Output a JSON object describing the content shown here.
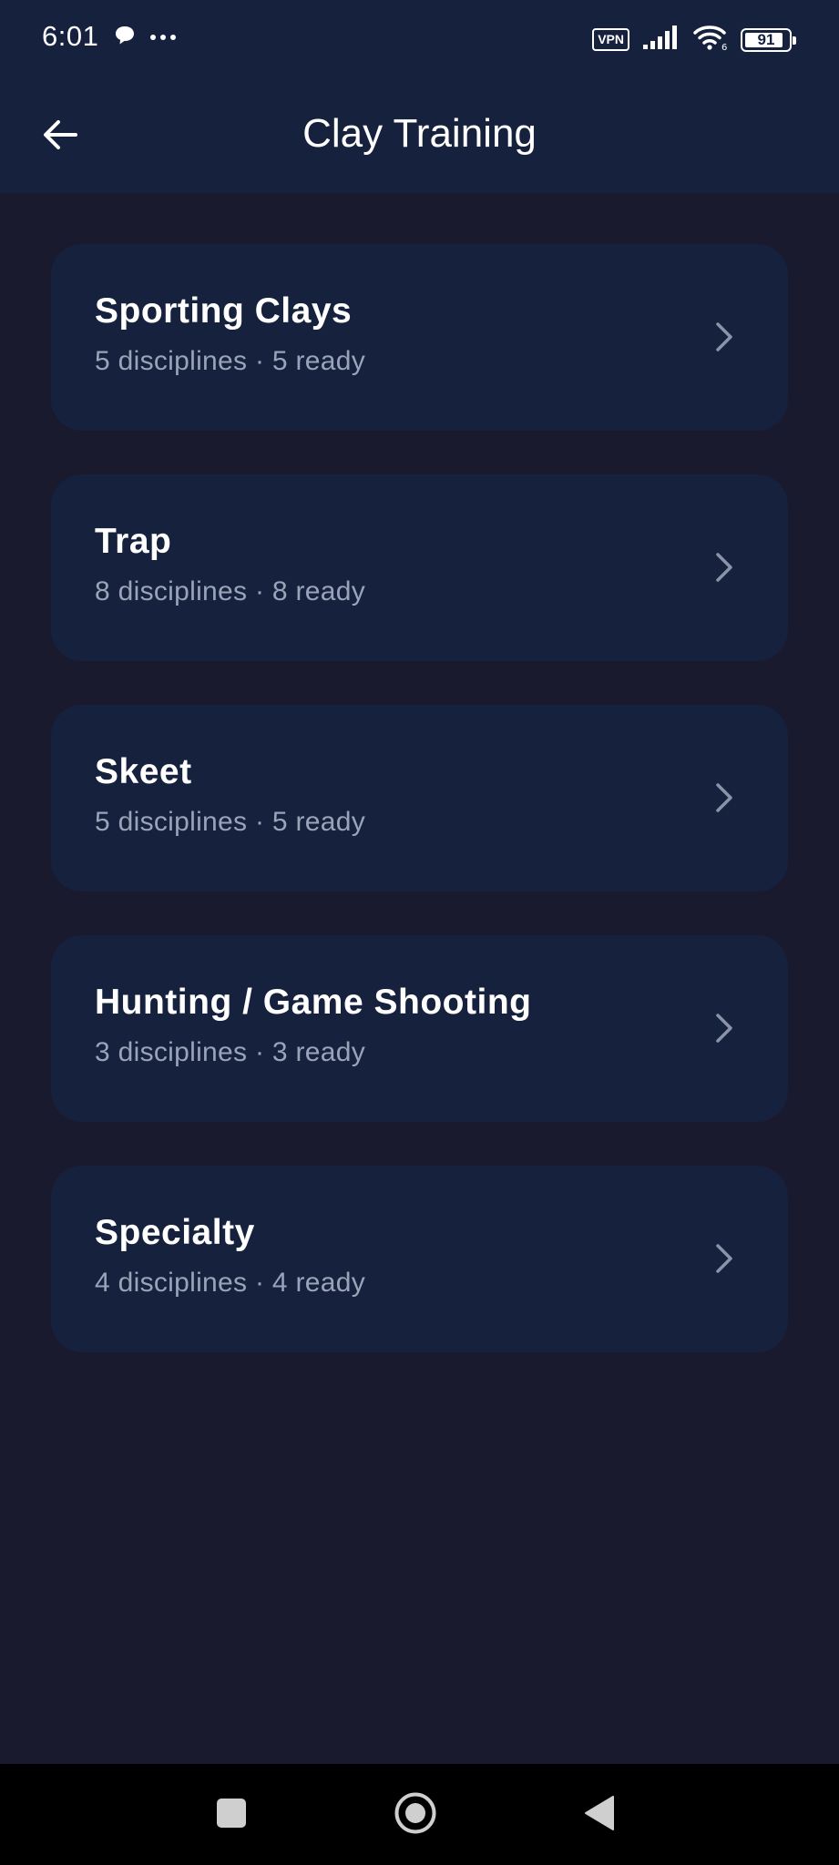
{
  "status_bar": {
    "time": "6:01",
    "vpn_label": "VPN",
    "battery_level": "91",
    "battery_fraction": 0.91,
    "icons": [
      "chat-bubble-icon",
      "more-dots-icon",
      "vpn-icon",
      "signal-icon",
      "wifi-icon",
      "battery-icon"
    ]
  },
  "app_bar": {
    "title": "Clay Training",
    "back_icon": "arrow-left-icon"
  },
  "categories": [
    {
      "title": "Sporting Clays",
      "subtitle": "5 disciplines · 5 ready"
    },
    {
      "title": "Trap",
      "subtitle": "8 disciplines · 8 ready"
    },
    {
      "title": "Skeet",
      "subtitle": "5 disciplines · 5 ready"
    },
    {
      "title": "Hunting / Game Shooting",
      "subtitle": "3 disciplines · 3 ready"
    },
    {
      "title": "Specialty",
      "subtitle": "4 disciplines · 4 ready"
    }
  ],
  "nav_bar": {
    "icons": [
      "recents-square-icon",
      "home-circle-icon",
      "back-triangle-icon"
    ]
  },
  "colors": {
    "background": "#1a1a2e",
    "surface": "#16213e",
    "text_primary": "#ffffff",
    "text_secondary": "#9aa3b8",
    "chevron": "#8a93a8",
    "nav_background": "#000000"
  }
}
